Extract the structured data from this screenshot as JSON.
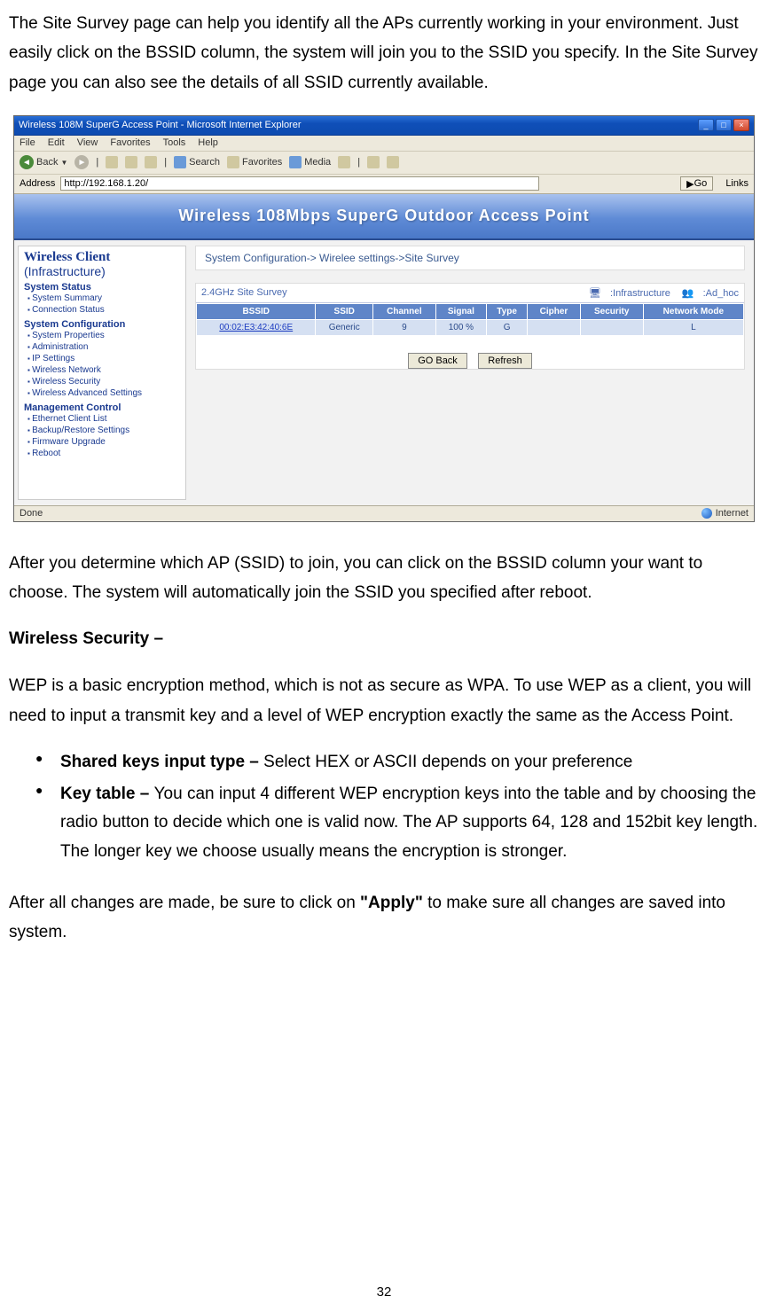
{
  "doc": {
    "para1": "The Site Survey page can help you identify all the APs currently working in your environment. Just easily click on the BSSID column, the system will join you to the SSID you specify. In the Site Survey page you can also see the details of all SSID currently available.",
    "para2": "After you determine which AP (SSID) to join, you can click on the BSSID column your want to choose. The system will automatically join the SSID you specified after reboot.",
    "subhead1": "Wireless Security –",
    "para3": "WEP is a basic encryption method, which is not as secure as WPA. To use WEP as a client, you will need to input a transmit key and a level of WEP encryption exactly the same as the Access Point.",
    "bullet1_bold": "Shared keys input type – ",
    "bullet1_rest": "Select HEX or ASCII depends on your preference",
    "bullet2_bold": "Key table – ",
    "bullet2_rest": "You can input 4 different WEP encryption keys into the table and by choosing the radio button to decide which one is valid now. The AP supports 64, 128 and 152bit key length. The longer key we choose usually means the encryption is stronger.",
    "para4_pre": "After all changes are made, be sure to click on ",
    "para4_bold": "\"Apply\"",
    "para4_post": " to make sure all changes are saved into system.",
    "page_number": "32"
  },
  "ie": {
    "title": "Wireless 108M SuperG Access Point - Microsoft Internet Explorer",
    "menu": {
      "file": "File",
      "edit": "Edit",
      "view": "View",
      "favorites": "Favorites",
      "tools": "Tools",
      "help": "Help"
    },
    "toolbar": {
      "back": "Back",
      "search": "Search",
      "favorites": "Favorites",
      "media": "Media"
    },
    "address_label": "Address",
    "address_value": "http://192.168.1.20/",
    "go": "Go",
    "links": "Links",
    "banner": "Wireless 108Mbps SuperG Outdoor Access Point",
    "status_done": "Done",
    "status_internet": "Internet"
  },
  "sidebar": {
    "title": "Wireless Client",
    "subtitle": "(Infrastructure)",
    "sec1": "System Status",
    "sec1_items": [
      "System Summary",
      "Connection Status"
    ],
    "sec2": "System Configuration",
    "sec2_items": [
      "System Properties",
      "Administration",
      "IP Settings",
      "Wireless Network",
      "Wireless Security",
      "Wireless Advanced Settings"
    ],
    "sec3": "Management Control",
    "sec3_items": [
      "Ethernet Client List",
      "Backup/Restore Settings",
      "Firmware Upgrade",
      "Reboot"
    ]
  },
  "main": {
    "breadcrumb": "System Configuration-> Wirelee settings->Site Survey",
    "survey_label": "2.4GHz Site Survey",
    "legend_infra": ":Infrastructure",
    "legend_adhoc": ":Ad_hoc",
    "columns": [
      "BSSID",
      "SSID",
      "Channel",
      "Signal",
      "Type",
      "Cipher",
      "Security",
      "Network Mode"
    ],
    "row": {
      "bssid": "00:02:E3:42:40:6E",
      "ssid": "Generic",
      "channel": "9",
      "signal": "100 %",
      "type": "G",
      "cipher": "",
      "security": "",
      "mode": "L"
    },
    "btn_goback": "GO Back",
    "btn_refresh": "Refresh"
  }
}
